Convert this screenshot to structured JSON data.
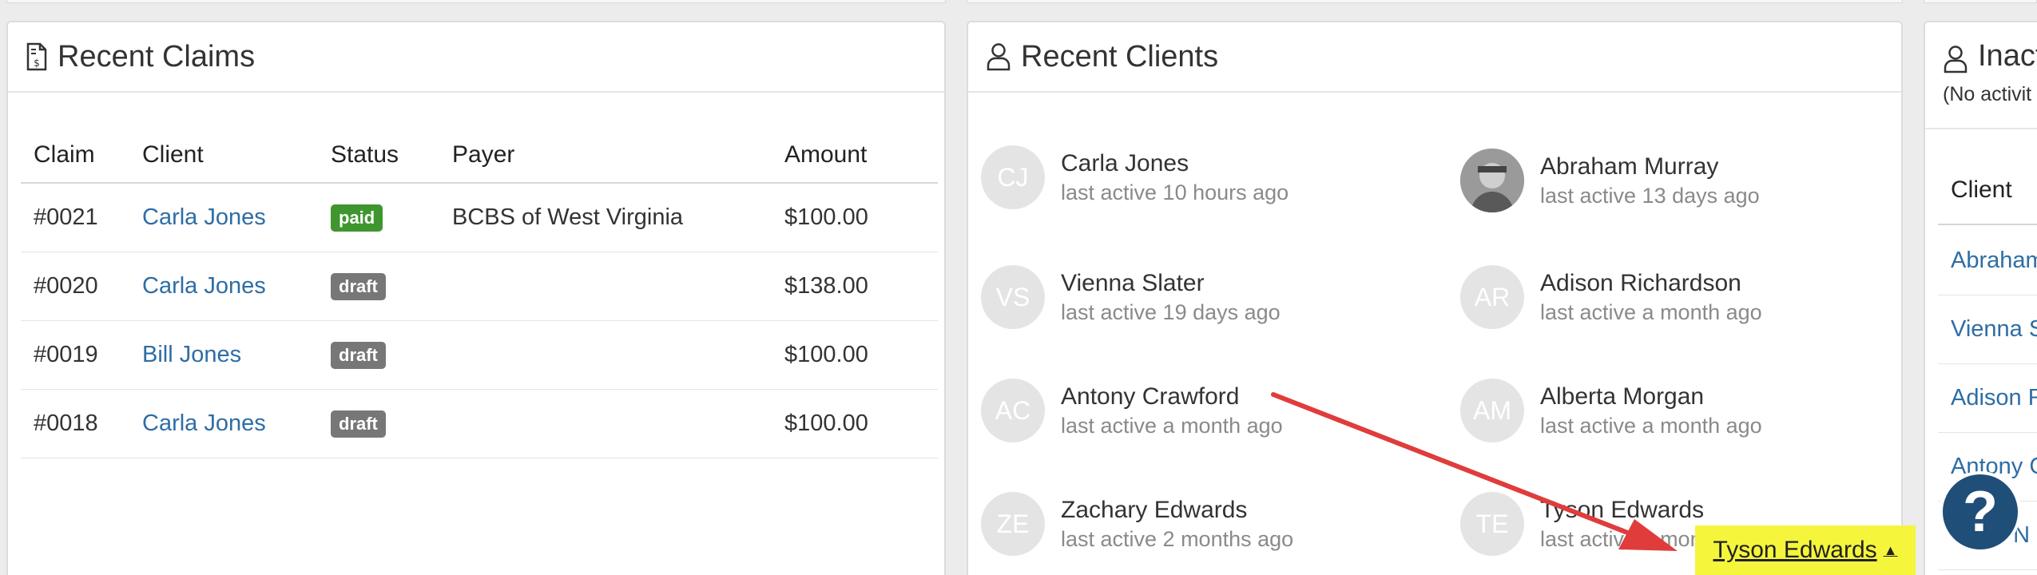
{
  "claims_panel": {
    "title": "Recent Claims",
    "icon": "invoice-dollar-icon",
    "columns": [
      "Claim",
      "Client",
      "Status",
      "Payer",
      "Amount"
    ],
    "rows": [
      {
        "claim": "#0021",
        "client": "Carla Jones",
        "status": "paid",
        "payer": "BCBS of West Virginia",
        "amount": "$100.00"
      },
      {
        "claim": "#0020",
        "client": "Carla Jones",
        "status": "draft",
        "payer": "",
        "amount": "$138.00"
      },
      {
        "claim": "#0019",
        "client": "Bill Jones",
        "status": "draft",
        "payer": "",
        "amount": "$100.00"
      },
      {
        "claim": "#0018",
        "client": "Carla Jones",
        "status": "draft",
        "payer": "",
        "amount": "$100.00"
      }
    ]
  },
  "clients_panel": {
    "title": "Recent Clients",
    "icon": "user-icon",
    "clients": [
      {
        "initials": "CJ",
        "name": "Carla Jones",
        "activity": "last active 10 hours ago"
      },
      {
        "initials": "",
        "name": "Abraham Murray",
        "activity": "last active 13 days ago",
        "photo": true
      },
      {
        "initials": "VS",
        "name": "Vienna Slater",
        "activity": "last active 19 days ago"
      },
      {
        "initials": "AR",
        "name": "Adison Richardson",
        "activity": "last active a month ago"
      },
      {
        "initials": "AC",
        "name": "Antony Crawford",
        "activity": "last active a month ago"
      },
      {
        "initials": "AM",
        "name": "Alberta Morgan",
        "activity": "last active a month ago"
      },
      {
        "initials": "ZE",
        "name": "Zachary Edwards",
        "activity": "last active 2 months ago"
      },
      {
        "initials": "TE",
        "name": "Tyson Edwards",
        "activity": "last active 2 months ago"
      }
    ]
  },
  "inactive_panel": {
    "title": "Inact",
    "subtitle": "(No activit",
    "column": "Client",
    "rows": [
      "Abraham",
      "Vienna S",
      "Adison R",
      "Antony C",
      "a N"
    ]
  },
  "help": {
    "label": "?"
  },
  "highlight": {
    "label": "Tyson Edwards",
    "caret": "▲",
    "arrow_color": "#e03c3c",
    "fill": "#f5f53b"
  },
  "colors": {
    "link": "#2e6da4",
    "paid": "#3f962f",
    "draft": "#777777",
    "help": "#1f4e79"
  }
}
